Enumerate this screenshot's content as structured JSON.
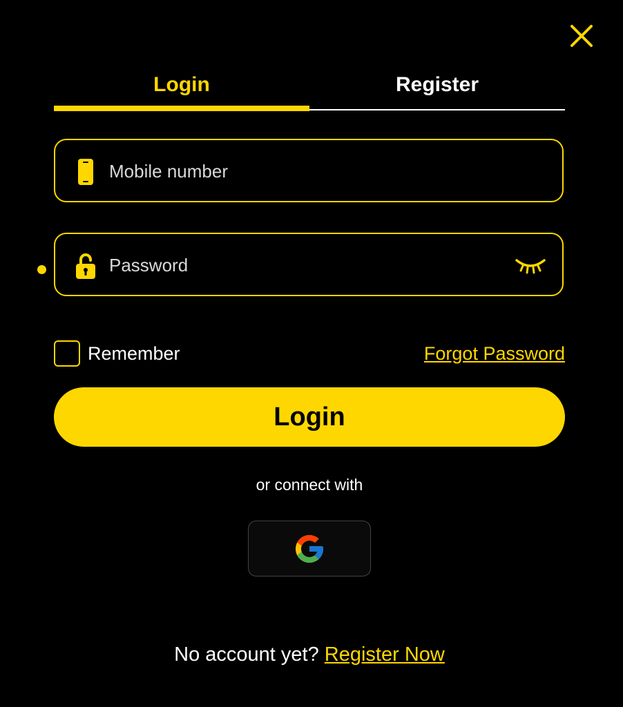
{
  "colors": {
    "accent": "#ffd700",
    "background": "#000000",
    "text": "#ffffff"
  },
  "icons": {
    "close": "close-icon",
    "mobile": "mobile-phone-icon",
    "lock": "lock-icon",
    "eye": "eye-closed-icon",
    "google": "google-icon"
  },
  "tabs": [
    {
      "label": "Login",
      "active": true
    },
    {
      "label": "Register",
      "active": false
    }
  ],
  "form": {
    "mobile": {
      "placeholder": "Mobile number",
      "value": ""
    },
    "password": {
      "placeholder": "Password",
      "value": ""
    },
    "remember_label": "Remember",
    "remember_checked": false,
    "forgot_label": "Forgot Password",
    "login_label": "Login"
  },
  "social": {
    "connect_label": "or connect with"
  },
  "footer": {
    "text": "No account yet?",
    "link_label": "Register Now"
  }
}
